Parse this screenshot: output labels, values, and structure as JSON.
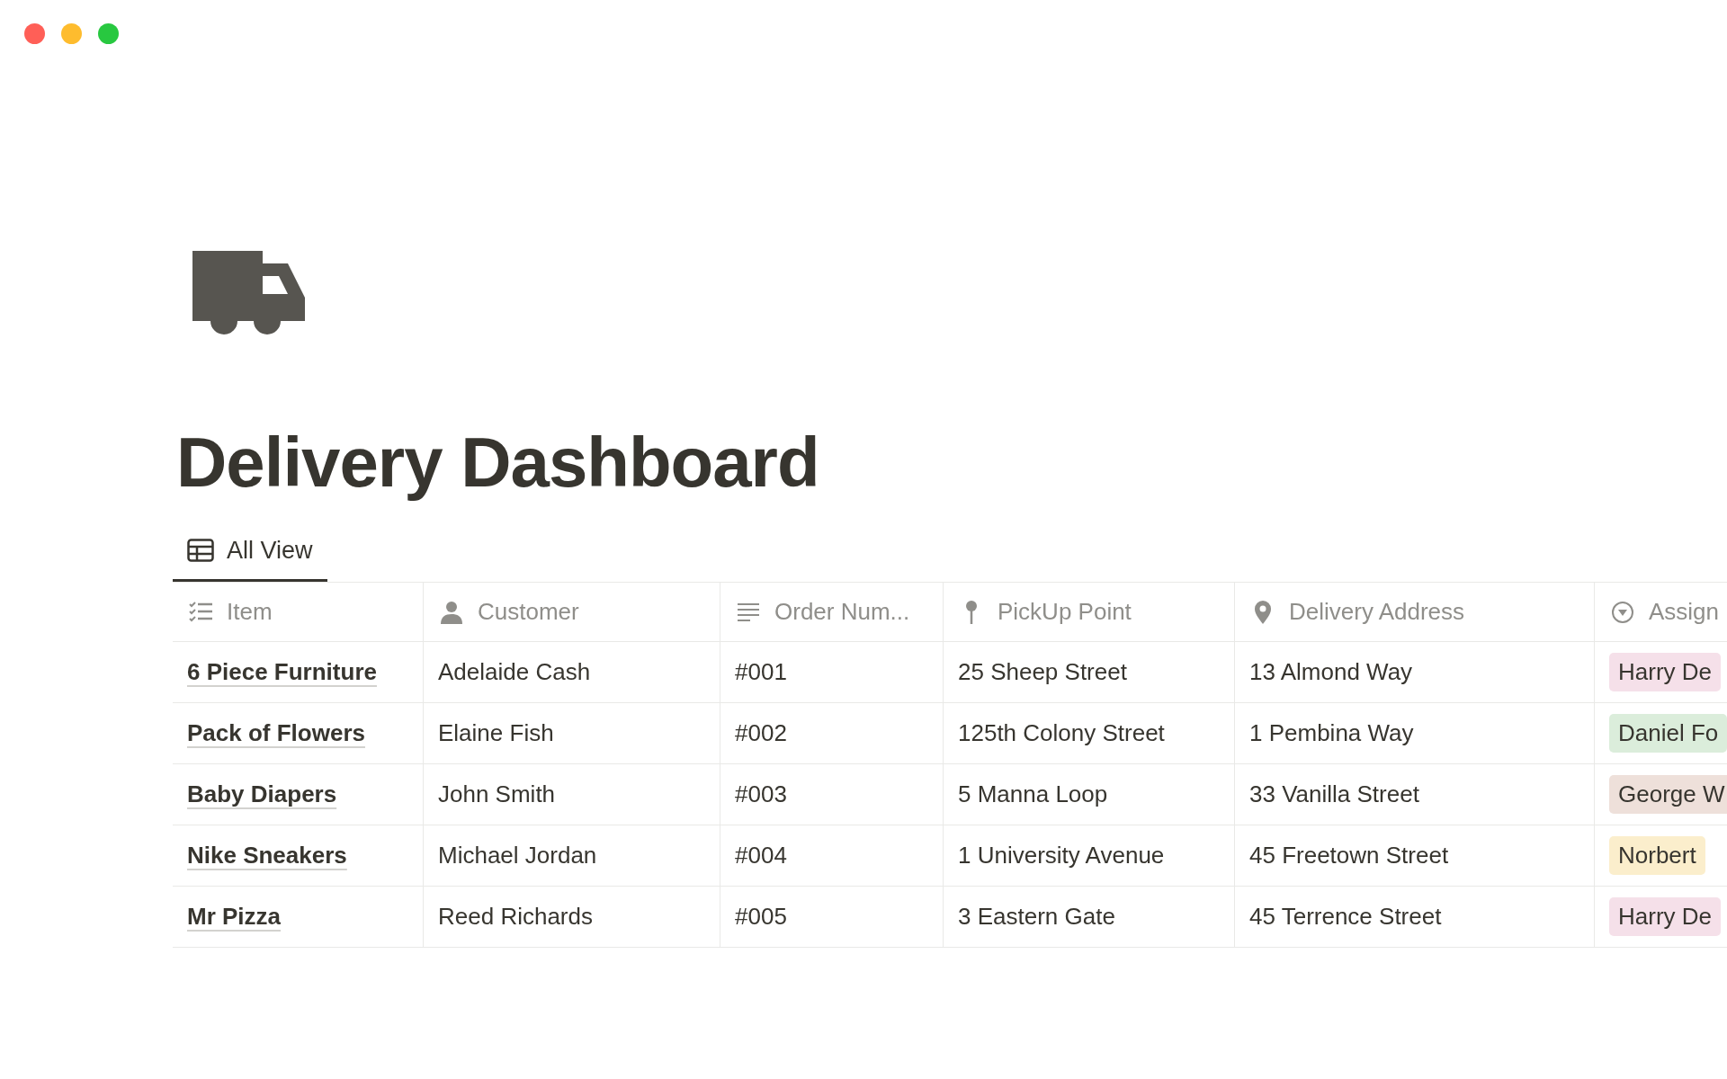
{
  "page": {
    "title": "Delivery Dashboard"
  },
  "views": [
    {
      "label": "All View",
      "selected": true
    }
  ],
  "table": {
    "columns": [
      {
        "label": "Item",
        "kind": "checklist"
      },
      {
        "label": "Customer",
        "kind": "person"
      },
      {
        "label": "Order Num...",
        "kind": "text"
      },
      {
        "label": "PickUp Point",
        "kind": "pin"
      },
      {
        "label": "Delivery Address",
        "kind": "location"
      },
      {
        "label": "Assign",
        "kind": "select"
      }
    ],
    "rows": [
      {
        "cells": [
          "6 Piece Furniture",
          "Adelaide Cash",
          "#001",
          "25 Sheep Street",
          "13 Almond Way"
        ],
        "assignee": {
          "label": "Harry De",
          "color": "#f5e0e9"
        }
      },
      {
        "cells": [
          "Pack of Flowers",
          "Elaine Fish",
          "#002",
          "125th Colony Street",
          "1 Pembina Way"
        ],
        "assignee": {
          "label": "Daniel Fo",
          "color": "#dbeddb"
        }
      },
      {
        "cells": [
          "Baby Diapers",
          "John Smith",
          "#003",
          "5 Manna Loop",
          "33 Vanilla Street"
        ],
        "assignee": {
          "label": "George W",
          "color": "#eee0da"
        }
      },
      {
        "cells": [
          "Nike Sneakers",
          "Michael Jordan",
          "#004",
          "1 University Avenue",
          "45 Freetown Street"
        ],
        "assignee": {
          "label": "Norbert",
          "color": "#fbeecc"
        }
      },
      {
        "cells": [
          "Mr Pizza",
          "Reed Richards",
          "#005",
          "3 Eastern Gate",
          "45 Terrence Street"
        ],
        "assignee": {
          "label": "Harry De",
          "color": "#f5e0e9"
        }
      }
    ]
  }
}
